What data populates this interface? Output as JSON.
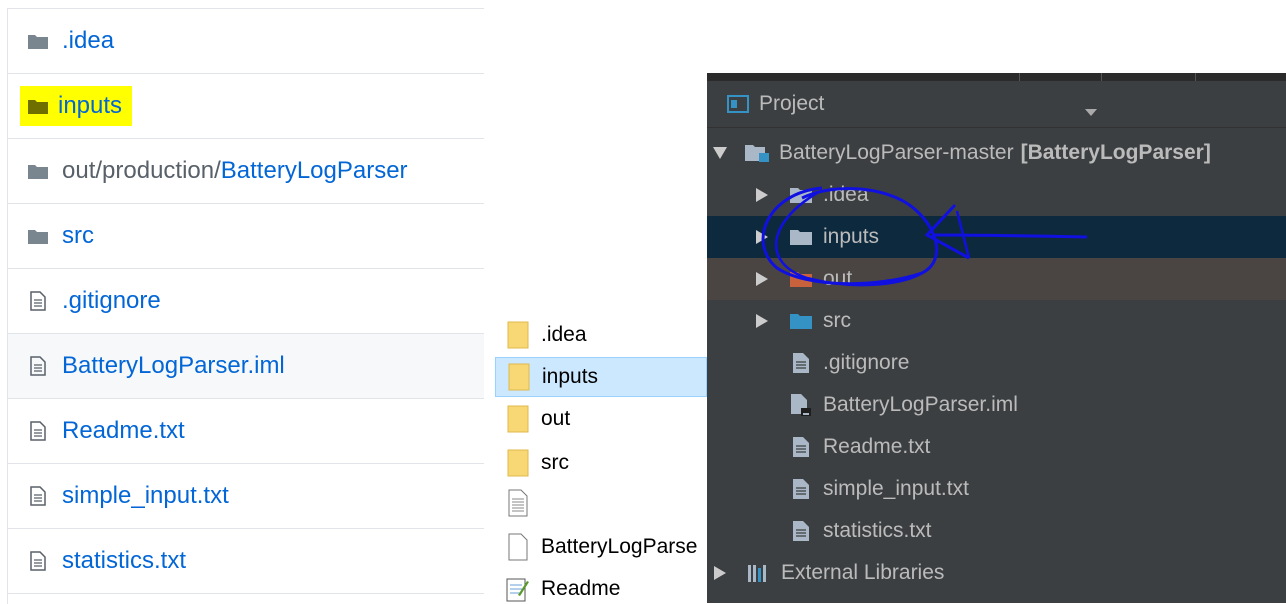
{
  "github_list": {
    "items": [
      {
        "type": "folder",
        "name": ".idea"
      },
      {
        "type": "folder",
        "name": "inputs",
        "highlight_color": "#ffff00"
      },
      {
        "type": "folder",
        "prefix": "out/production/",
        "name": "BatteryLogParser"
      },
      {
        "type": "folder",
        "name": "src"
      },
      {
        "type": "file",
        "name": ".gitignore"
      },
      {
        "type": "file",
        "name": "BatteryLogParser.iml"
      },
      {
        "type": "file",
        "name": "Readme.txt"
      },
      {
        "type": "file",
        "name": "simple_input.txt"
      },
      {
        "type": "file",
        "name": "statistics.txt"
      }
    ]
  },
  "explorer_list": {
    "items": [
      {
        "type": "folder",
        "name": ".idea"
      },
      {
        "type": "folder",
        "name": "inputs",
        "selected": true
      },
      {
        "type": "folder",
        "name": "out"
      },
      {
        "type": "folder",
        "name": "src"
      },
      {
        "type": "text-file",
        "name": ""
      },
      {
        "type": "blank-file",
        "name": "BatteryLogParse"
      },
      {
        "type": "notepad-file",
        "name": "Readme"
      }
    ]
  },
  "ide_panel": {
    "header_title": "Project",
    "root": {
      "name": "BatteryLogParser-master",
      "module": "[BatteryLogParser]"
    },
    "children": [
      {
        "type": "folder",
        "name": ".idea"
      },
      {
        "type": "folder",
        "name": "inputs",
        "selected": true
      },
      {
        "type": "folder-excluded",
        "name": "out"
      },
      {
        "type": "folder-source",
        "name": "src"
      },
      {
        "type": "file",
        "name": ".gitignore"
      },
      {
        "type": "iml-file",
        "name": "BatteryLogParser.iml"
      },
      {
        "type": "file",
        "name": "Readme.txt"
      },
      {
        "type": "file",
        "name": "simple_input.txt"
      },
      {
        "type": "file",
        "name": "statistics.txt"
      }
    ],
    "external_libraries": "External Libraries",
    "annotation_color": "#1010e0"
  },
  "colors": {
    "github_link": "#0366d6",
    "github_folder": "#79858f",
    "explorer_folder": "#f8d775",
    "explorer_selection": "#cce8ff",
    "ide_background": "#3c3f41",
    "ide_selection": "#0d293e",
    "ide_folder": "#a9b7c6",
    "ide_source_folder": "#3592c4",
    "ide_excluded_folder": "#c8623c"
  }
}
